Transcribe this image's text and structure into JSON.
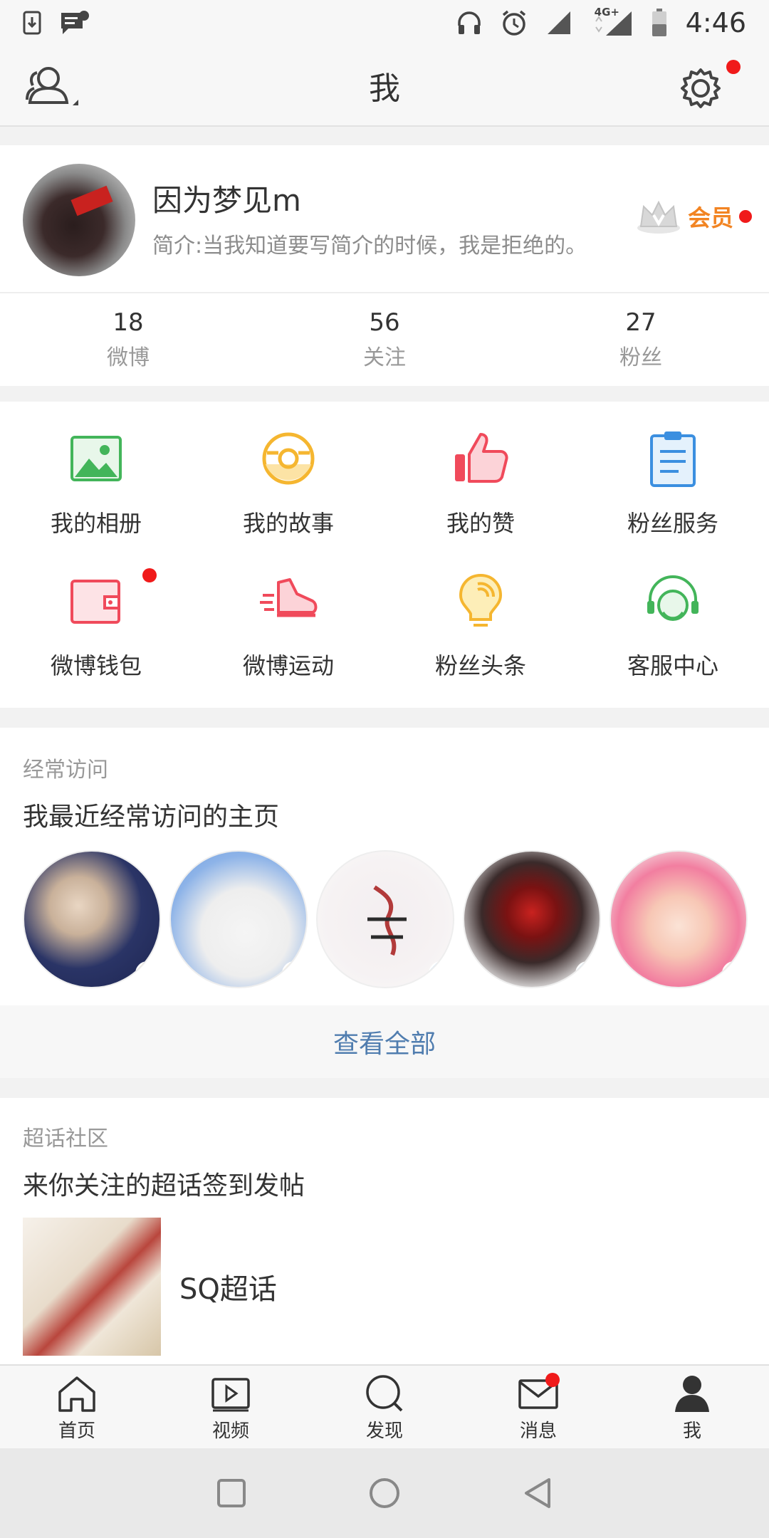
{
  "status_bar": {
    "time": "4:46",
    "network": "4G+"
  },
  "header": {
    "title": "我"
  },
  "profile": {
    "username": "因为梦见m",
    "bio": "简介:当我知道要写简介的时候，我是拒绝的。",
    "vip_label": "会员"
  },
  "stats": [
    {
      "num": "18",
      "label": "微博"
    },
    {
      "num": "56",
      "label": "关注"
    },
    {
      "num": "27",
      "label": "粉丝"
    }
  ],
  "grid": [
    {
      "label": "我的相册",
      "icon": "photo-album-icon"
    },
    {
      "label": "我的故事",
      "icon": "story-icon"
    },
    {
      "label": "我的赞",
      "icon": "thumbs-up-icon"
    },
    {
      "label": "粉丝服务",
      "icon": "clipboard-icon"
    },
    {
      "label": "微博钱包",
      "icon": "wallet-icon"
    },
    {
      "label": "微博运动",
      "icon": "sneaker-icon"
    },
    {
      "label": "粉丝头条",
      "icon": "lightbulb-icon"
    },
    {
      "label": "客服中心",
      "icon": "headset-icon"
    }
  ],
  "frequent": {
    "caption": "经常访问",
    "title": "我最近经常访问的主页",
    "badge_text": "V",
    "view_all": "查看全部"
  },
  "topics": {
    "caption": "超话社区",
    "title": "来你关注的超话签到发帖",
    "item_name": "SQ超话"
  },
  "tabbar": [
    {
      "label": "首页",
      "icon": "home-icon"
    },
    {
      "label": "视频",
      "icon": "video-icon"
    },
    {
      "label": "发现",
      "icon": "search-icon"
    },
    {
      "label": "消息",
      "icon": "mail-icon"
    },
    {
      "label": "我",
      "icon": "profile-icon"
    }
  ],
  "colors": {
    "accent_orange": "#f28422",
    "link_blue": "#507daf",
    "badge_red": "#f01a1a"
  }
}
